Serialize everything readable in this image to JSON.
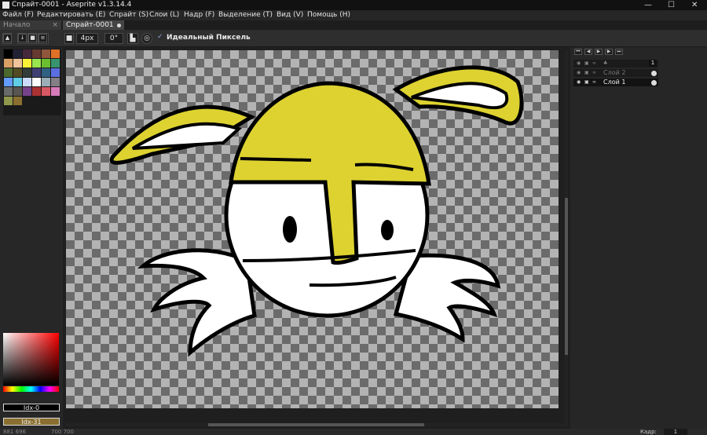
{
  "window": {
    "title": "Спрайт-0001 - Aseprite v1.3.14.4",
    "controls": [
      "—",
      "☐",
      "✕"
    ]
  },
  "menu": [
    "Файл (F)",
    "Редактировать (E)",
    "Спрайт (S)",
    "Слои (L)",
    "Надр (F)",
    "Выделение (T)",
    "Вид (V)",
    "Помощь (H)"
  ],
  "tabs": [
    {
      "label": "Начало",
      "active": false
    },
    {
      "label": "Спрайт-0001",
      "active": true
    }
  ],
  "toolbar": {
    "brush_size": "4px",
    "brush_angle": "0°",
    "pixel_perfect_label": "Идеальный Пиксель",
    "pixel_perfect_checked": true
  },
  "palette": {
    "colors": [
      "#000000",
      "#222034",
      "#45283c",
      "#663931",
      "#8f563b",
      "#df7126",
      "#d9a066",
      "#eec39a",
      "#fbf236",
      "#99e550",
      "#6abe30",
      "#37946e",
      "#4b692f",
      "#524b24",
      "#323c39",
      "#3f3f74",
      "#306082",
      "#5b6ee1",
      "#639bff",
      "#5fcde4",
      "#cbdbfc",
      "#ffffff",
      "#9badb7",
      "#847e87",
      "#696a6a",
      "#595652",
      "#76428a",
      "#ac3232",
      "#d95763",
      "#d77bba",
      "#8f974a",
      "#8a6f30"
    ],
    "foreground_index": "Idx-0",
    "background_index": "Idx-31"
  },
  "layers": [
    {
      "name": "",
      "frame_number": "1"
    },
    {
      "name": "Слой 2",
      "visible": false
    },
    {
      "name": "Слой 1",
      "visible": true,
      "selected": true
    }
  ],
  "timeline_buttons": [
    "⏮",
    "◀",
    "▶",
    "▶",
    "⏭"
  ],
  "status": {
    "coords": "881 696",
    "size": "700 700",
    "frame_label": "Кадр:",
    "frame_value": "1"
  },
  "colors": {
    "ears_and_cap": "#ddd230",
    "face": "#ffffff",
    "outline": "#000000"
  }
}
